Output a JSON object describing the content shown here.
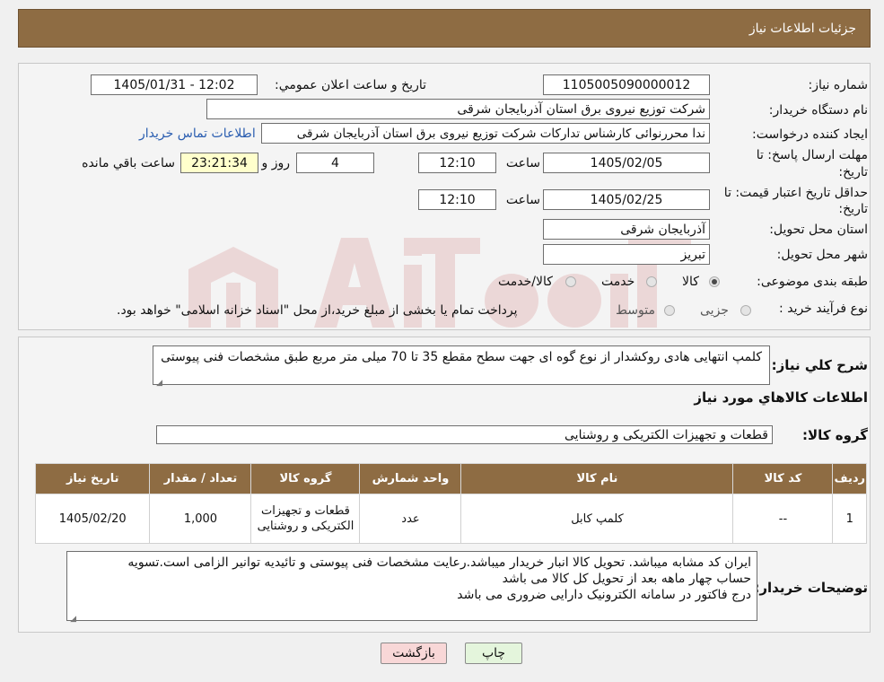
{
  "header": {
    "title": "جزئیات اطلاعات نیاز"
  },
  "form": {
    "need_number_label": "شماره نیاز:",
    "need_number": "1105005090000012",
    "announce_label": "تاریخ و ساعت اعلان عمومي:",
    "announce_value": "1405/01/31 - 12:02",
    "buyer_org_label": "نام دستگاه خريدار:",
    "buyer_org": "شرکت توزیع نیروی برق استان آذربایجان شرقی",
    "creator_label": "ایجاد کننده درخواست:",
    "creator": "ندا محررنوائی کارشناس تدارکات شرکت توزیع نیروی برق استان آذربایجان شرقی",
    "contact_link": "اطلاعات تماس خریدار",
    "deadline_label_1": "مهلت ارسال پاسخ: تا",
    "deadline_label_2": "تاریخ:",
    "deadline_date": "1405/02/05",
    "time_label": "ساعت",
    "deadline_time": "12:10",
    "days_value": "4",
    "days_label": "روز و",
    "remaining_time": "23:21:34",
    "remaining_label": "ساعت باقي مانده",
    "validity_label_1": "حداقل تاریخ اعتبار قیمت: تا",
    "validity_label_2": "تاریخ:",
    "validity_date": "1405/02/25",
    "validity_time": "12:10",
    "province_label": "استان محل تحویل:",
    "province": "آذربایجان شرقی",
    "city_label": "شهر محل تحویل:",
    "city": "تبریز",
    "category_label": "طبقه بندی موضوعی:",
    "category_options": [
      "کالا",
      "خدمت",
      "کالا/خدمت"
    ],
    "category_selected": "کالا",
    "process_label": "نوع فرآیند خرید :",
    "process_options": [
      "جزیی",
      "متوسط"
    ],
    "process_note": "پرداخت تمام یا بخشی از مبلغ خرید،از محل \"اسناد خزانه اسلامی\" خواهد بود."
  },
  "details": {
    "description_label": "شرح کلي نياز:",
    "description": "کلمپ انتهایی هادی روکشدار از نوع گوه ای جهت سطح مقطع 35 تا 70 میلی متر مربع طبق مشخصات فنی پیوستی",
    "goods_info_title": "اطلاعات کالاهاي مورد نياز",
    "goods_group_label": "گروه کالا:",
    "goods_group": "قطعات و تجهیزات الکتریکی و روشنایی"
  },
  "table": {
    "headers": [
      "ردیف",
      "کد کالا",
      "نام کالا",
      "واحد شمارش",
      "گروه کالا",
      "تعداد / مقدار",
      "تاریخ نیاز"
    ],
    "rows": [
      [
        "1",
        "--",
        "کلمپ کابل",
        "عدد",
        "قطعات و تجهیزات الکتریکی و روشنایی",
        "1,000",
        "1405/02/20"
      ]
    ]
  },
  "buyer_notes": {
    "label": "توضیحات خریدار:",
    "lines": [
      "ایران کد مشابه میباشد. تحویل کالا انبار خریدار میباشد.رعایت مشخصات فنی پیوستی و تائیدیه توانیر الزامی است.تسویه",
      "حساب چهار ماهه بعد از تحویل کل کالا می باشد",
      "درج فاکتور در سامانه الکترونیک دارایی ضروری می باشد"
    ]
  },
  "buttons": {
    "print": "چاپ",
    "back": "بازگشت"
  },
  "colors": {
    "header": "#8e6c43",
    "back_button": "#f8d7d7",
    "print_button": "#e4f5dc"
  }
}
